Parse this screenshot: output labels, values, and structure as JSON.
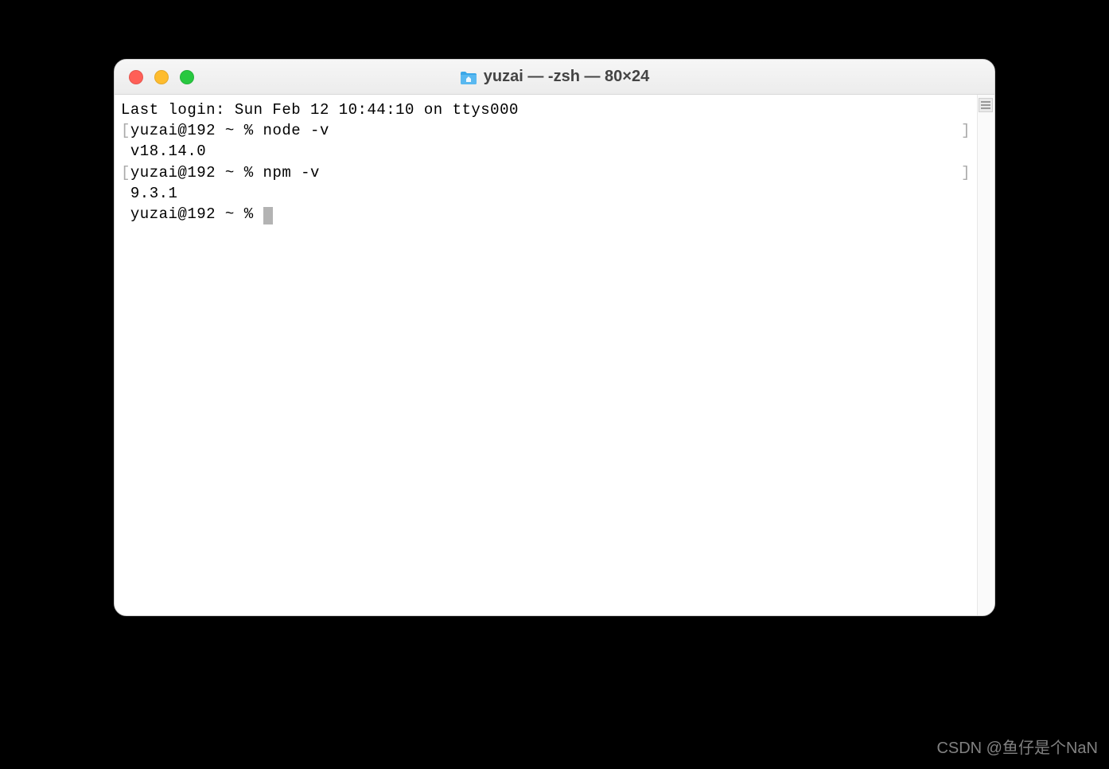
{
  "window": {
    "title": "yuzai — -zsh — 80×24"
  },
  "terminal": {
    "last_login": "Last login: Sun Feb 12 10:44:10 on ttys000",
    "lines": [
      {
        "prompt_left": "[",
        "prompt": "yuzai@192 ~ % ",
        "command": "node -v",
        "prompt_right": "]"
      },
      {
        "output": "v18.14.0"
      },
      {
        "prompt_left": "[",
        "prompt": "yuzai@192 ~ % ",
        "command": "npm -v",
        "prompt_right": "]"
      },
      {
        "output": "9.3.1"
      },
      {
        "prompt_left": " ",
        "prompt": "yuzai@192 ~ % ",
        "cursor": true
      }
    ]
  },
  "watermark": "CSDN @鱼仔是个NaN"
}
